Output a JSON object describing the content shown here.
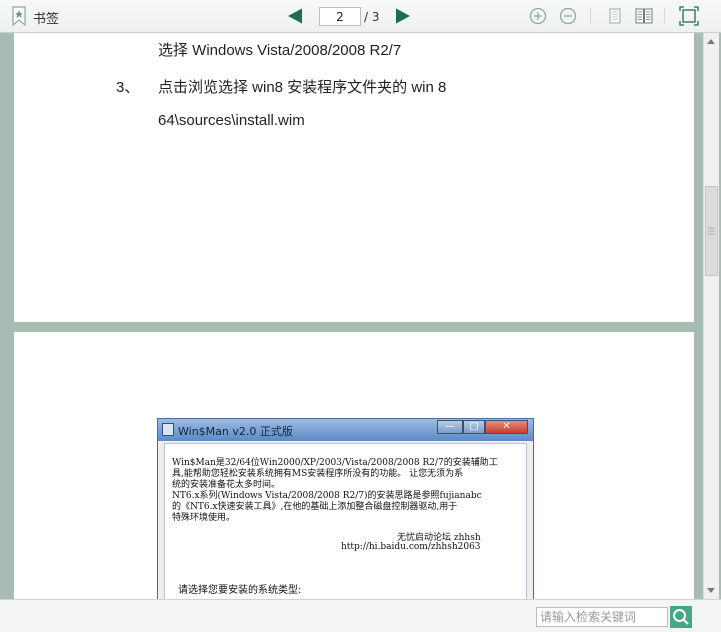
{
  "toolbar": {
    "bookmark_label": "书签",
    "current_page": "2",
    "total_pages": "/ 3"
  },
  "page1": {
    "line1": "选择 Windows Vista/2008/2008 R2/7",
    "step_number": "3、",
    "line2": "点击浏览选择 win8 安装程序文件夹的 win 8",
    "line3": "64\\sources\\install.wim"
  },
  "embedded_window": {
    "title": "Win$Man v2.0 正式版",
    "desc_lines": [
      "Win$Man是32/64位Win2000/XP/2003/Vista/2008/2008 R2/7的安装辅助工",
      "具,能帮助您轻松安装系统拥有MS安装程序所没有的功能。 让您无须为系",
      "统的安装准备花太多时间。",
      "NT6.x系列(Windows Vista/2008/2008 R2/7)的安装思路是参照fujianabc",
      "的《NT6.x快速安装工具》,在他的基础上添加整合磁盘控制器驱动,用于",
      "特殊环境使用。"
    ],
    "sig_name": "无忧启动论坛  zhhsh",
    "sig_url": "http://hi.baidu.com/zhhsh2063",
    "prompt": "请选择您要安装的系统类型:"
  },
  "search": {
    "placeholder": "请输入检索关键词"
  },
  "colors": {
    "viewer_background": "#a7bcb3",
    "accent": "#44a886"
  },
  "icons": [
    "bookmark-icon",
    "prev-page-icon",
    "next-page-icon",
    "zoom-in-icon",
    "zoom-out-icon",
    "single-page-icon",
    "two-page-icon",
    "fullscreen-icon",
    "search-icon"
  ]
}
